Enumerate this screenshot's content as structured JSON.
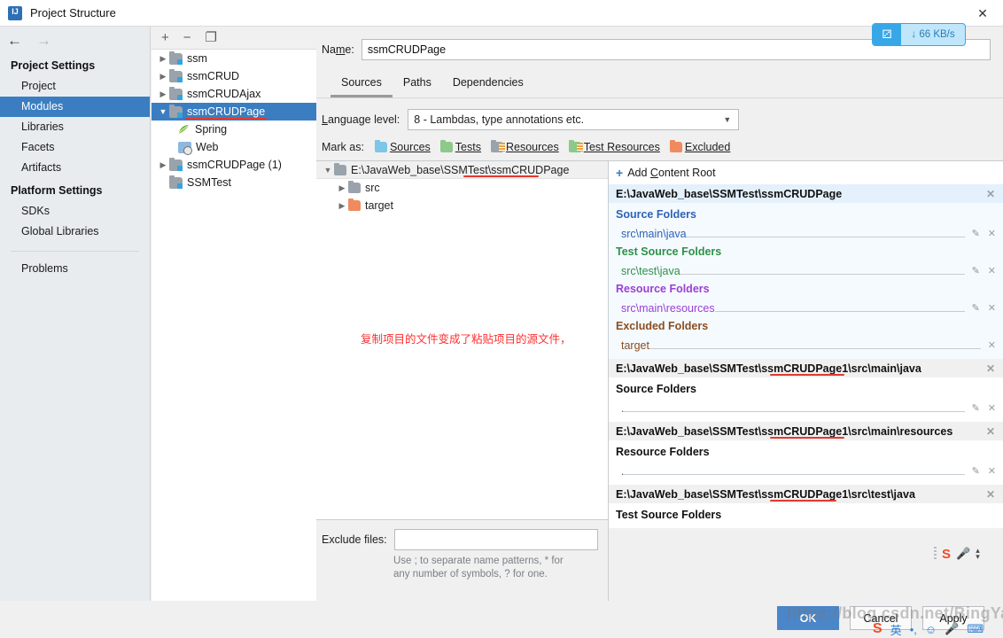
{
  "window": {
    "title": "Project Structure",
    "app_icon": "intellij-idea-icon",
    "close_label": "✕"
  },
  "sidebar": {
    "nav": {
      "back": "←",
      "forward": "→"
    },
    "groups": [
      {
        "label": "Project Settings",
        "items": [
          {
            "label": "Project",
            "selected": false
          },
          {
            "label": "Modules",
            "selected": true
          },
          {
            "label": "Libraries",
            "selected": false
          },
          {
            "label": "Facets",
            "selected": false
          },
          {
            "label": "Artifacts",
            "selected": false
          }
        ]
      },
      {
        "label": "Platform Settings",
        "items": [
          {
            "label": "SDKs",
            "selected": false
          },
          {
            "label": "Global Libraries",
            "selected": false
          }
        ]
      }
    ],
    "problems_label": "Problems",
    "help_label": "?"
  },
  "module_panel": {
    "toolbar": {
      "add": "+",
      "remove": "−",
      "copy": "❐"
    },
    "tree": [
      {
        "label": "ssm",
        "twisty": "▶",
        "icon": "module-folder-icon",
        "indent": 0,
        "selected": false,
        "underlined": false
      },
      {
        "label": "ssmCRUD",
        "twisty": "▶",
        "icon": "module-folder-icon",
        "indent": 0,
        "selected": false,
        "underlined": false
      },
      {
        "label": "ssmCRUDAjax",
        "twisty": "▶",
        "icon": "module-folder-icon",
        "indent": 0,
        "selected": false,
        "underlined": false
      },
      {
        "label": "ssmCRUDPage",
        "twisty": "▼",
        "icon": "module-folder-icon",
        "indent": 0,
        "selected": true,
        "underlined": true
      },
      {
        "label": "Spring",
        "twisty": "",
        "icon": "spring-leaf-icon",
        "indent": 1,
        "selected": false,
        "underlined": false
      },
      {
        "label": "Web",
        "twisty": "",
        "icon": "web-facet-icon",
        "indent": 1,
        "selected": false,
        "underlined": false
      },
      {
        "label": "ssmCRUDPage (1)",
        "twisty": "▶",
        "icon": "module-folder-icon",
        "indent": 0,
        "selected": false,
        "underlined": false
      },
      {
        "label": "SSMTest",
        "twisty": "",
        "icon": "module-folder-icon",
        "indent": 0,
        "selected": false,
        "underlined": false
      }
    ]
  },
  "main": {
    "name_label": "Name:",
    "name_value": "ssmCRUDPage",
    "tabs": [
      {
        "label": "Sources",
        "active": true
      },
      {
        "label": "Paths",
        "active": false
      },
      {
        "label": "Dependencies",
        "active": false
      }
    ],
    "language_level_label": "Language level:",
    "language_level_value": "8 - Lambdas, type annotations etc.",
    "mark_as_label": "Mark as:",
    "mark_as_options": [
      {
        "label": "Sources",
        "color": "#7cc6e8",
        "kind": "src"
      },
      {
        "label": "Tests",
        "color": "#8cc98a",
        "kind": "tst"
      },
      {
        "label": "Resources",
        "color": "#9aa3ab",
        "kind": "res"
      },
      {
        "label": "Test Resources",
        "color": "#8cc98a",
        "kind": "tres"
      },
      {
        "label": "Excluded",
        "color": "#ef8b5e",
        "kind": "exc"
      }
    ]
  },
  "folder_tree": {
    "root": {
      "label": "E:\\JavaWeb_base\\SSMTest\\ssmCRUDPage",
      "twisty": "▼",
      "icon": "folder-icon",
      "underlined": true
    },
    "children": [
      {
        "label": "src",
        "twisty": "▶",
        "icon": "folder-icon",
        "color": "gray"
      },
      {
        "label": "target",
        "twisty": "▶",
        "icon": "excluded-folder-icon",
        "color": "orange"
      }
    ],
    "annotation": "复制项目的文件变成了粘贴项目的源文件，"
  },
  "content_roots": {
    "add_label": "Add Content Root",
    "add_icon": "plus-icon",
    "roots": [
      {
        "path": "E:\\JavaWeb_base\\SSMTest\\ssmCRUDPage",
        "highlighted": true,
        "underlined": false,
        "categories": [
          {
            "title": "Source Folders",
            "kind": "src",
            "entries": [
              {
                "value": "src\\main\\java",
                "has_edit": true
              }
            ]
          },
          {
            "title": "Test Source Folders",
            "kind": "tst",
            "entries": [
              {
                "value": "src\\test\\java",
                "has_edit": true
              }
            ]
          },
          {
            "title": "Resource Folders",
            "kind": "res",
            "entries": [
              {
                "value": "src\\main\\resources",
                "has_edit": true
              }
            ]
          },
          {
            "title": "Excluded Folders",
            "kind": "exc",
            "entries": [
              {
                "value": "target",
                "has_edit": false
              }
            ]
          }
        ]
      },
      {
        "path": "E:\\JavaWeb_base\\SSMTest\\ssmCRUDPage1\\src\\main\\java",
        "highlighted": false,
        "underlined": true,
        "categories": [
          {
            "title": "Source Folders",
            "kind": "plain",
            "entries": [
              {
                "value": ".",
                "has_edit": true
              }
            ]
          }
        ]
      },
      {
        "path": "E:\\JavaWeb_base\\SSMTest\\ssmCRUDPage1\\src\\main\\resources",
        "highlighted": false,
        "underlined": true,
        "categories": [
          {
            "title": "Resource Folders",
            "kind": "plain",
            "entries": [
              {
                "value": ".",
                "has_edit": true
              }
            ]
          }
        ]
      },
      {
        "path": "E:\\JavaWeb_base\\SSMTest\\ssmCRUDPage1\\src\\test\\java",
        "highlighted": false,
        "underlined": true,
        "categories": [
          {
            "title": "Test Source Folders",
            "kind": "plain",
            "entries": [
              {
                "value": ".",
                "has_edit": false
              }
            ]
          }
        ]
      }
    ],
    "edit_icon": "pencil-icon",
    "remove_icon": "close-icon"
  },
  "exclude_files": {
    "label": "Exclude files:",
    "value": "",
    "hint_line1": "Use ; to separate name patterns, * for",
    "hint_line2": "any number of symbols, ? for one."
  },
  "buttons": {
    "ok": "OK",
    "cancel": "Cancel",
    "apply": "Apply"
  },
  "overlays": {
    "network_speed": {
      "icon": "baidu-netdisk-icon",
      "value": "↓ 66 KB/s"
    },
    "watermark": "https://blog.csdn.net/BingYaiLi",
    "ime": {
      "sogou": "S",
      "keyboard": "⌨",
      "mic": "Ἲ4"
    }
  },
  "colors": {
    "selection_blue": "#3a7ec1",
    "primary_button": "#4a86c8",
    "source_blue": "#2d63b5",
    "test_green": "#2e9147",
    "resource_purple": "#9b3fd4",
    "excluded_brown": "#8a4e20",
    "annotation_red": "#ff2f2f",
    "underline_red": "#e03a2f"
  }
}
